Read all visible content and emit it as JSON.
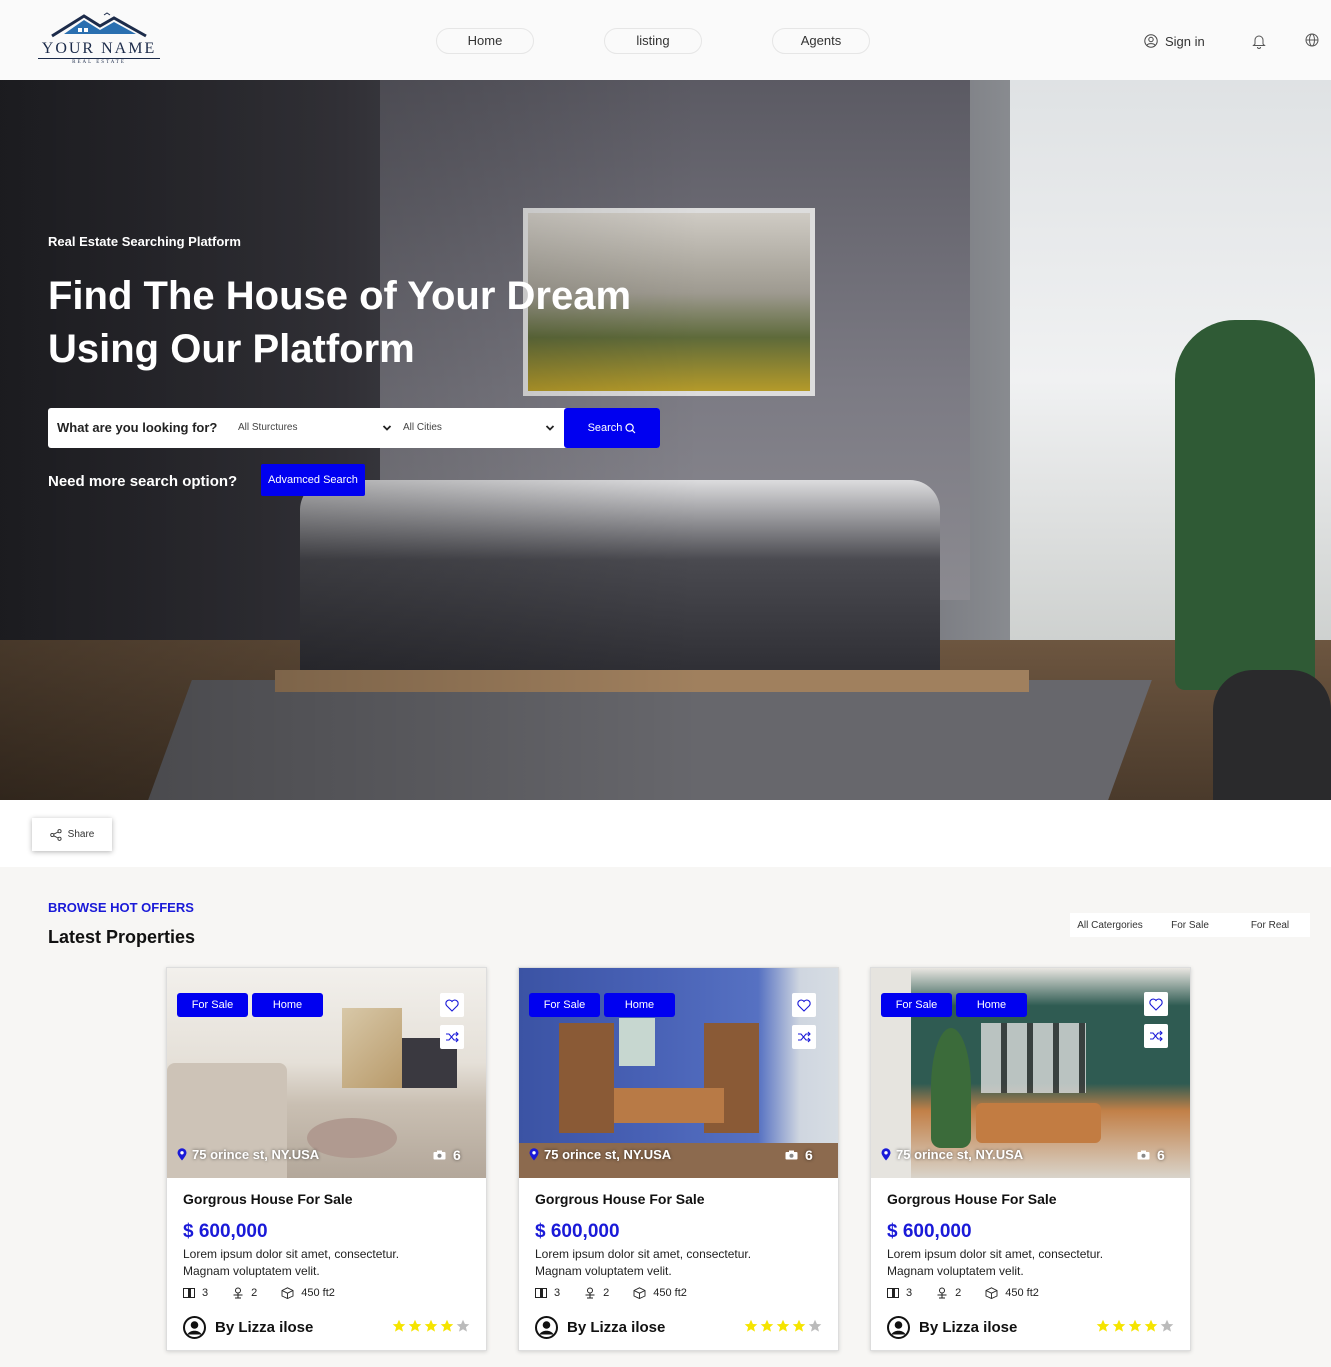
{
  "header": {
    "logo": {
      "name": "YOUR NAME",
      "sub": "REAL ESTATE"
    },
    "nav": [
      "Home",
      "listing",
      "Agents"
    ],
    "signin_label": "Sign in"
  },
  "hero": {
    "tag": "Real Estate Searching Platform",
    "title_line1": "Find The House of Your Dream",
    "title_line2": "Using Our Platform",
    "search": {
      "label": "What are you looking for?",
      "structures_value": "All Sturctures",
      "cities_value": "All Cities",
      "button_label": "Search"
    },
    "more_label": "Need more search option?",
    "advanced_label": "Advamced Search"
  },
  "share_label": "Share",
  "section": {
    "eyebrow": "BROWSE HOT OFFERS",
    "title": "Latest Properties",
    "filters": [
      "All Catergories",
      "For Sale",
      "For Real"
    ]
  },
  "properties": [
    {
      "badges": [
        "For Sale",
        "Home"
      ],
      "address": "75 orince st, NY.USA",
      "photos": "6",
      "title": "Gorgrous House For Sale",
      "price": "$ 600,000",
      "desc_line1": "Lorem ipsum dolor sit amet, consectetur.",
      "desc_line2": "Magnam voluptatem velit.",
      "beds": "3",
      "baths": "2",
      "area": "450 ft2",
      "agent": "By Lizza ilose",
      "rating": 4
    },
    {
      "badges": [
        "For Sale",
        "Home"
      ],
      "address": "75 orince st, NY.USA",
      "photos": "6",
      "title": "Gorgrous House For Sale",
      "price": "$ 600,000",
      "desc_line1": "Lorem ipsum dolor sit amet, consectetur.",
      "desc_line2": "Magnam voluptatem velit.",
      "beds": "3",
      "baths": "2",
      "area": "450 ft2",
      "agent": "By Lizza ilose",
      "rating": 4
    },
    {
      "badges": [
        "For Sale",
        "Home"
      ],
      "address": "75 orince st, NY.USA",
      "photos": "6",
      "title": "Gorgrous House For Sale",
      "price": "$ 600,000",
      "desc_line1": "Lorem ipsum dolor sit amet, consectetur.",
      "desc_line2": "Magnam voluptatem velit.",
      "beds": "3",
      "baths": "2",
      "area": "450 ft2",
      "agent": "By Lizza ilose",
      "rating": 4
    }
  ],
  "colors": {
    "accent": "#0000f0",
    "price": "#1a1ad8",
    "star": "#f5e400",
    "star_empty": "#bbbbbb"
  },
  "icons": [
    "user-icon",
    "bell-icon",
    "globe-icon",
    "chevron-down-icon",
    "search-icon",
    "share-icon",
    "heart-icon",
    "shuffle-icon",
    "location-pin-icon",
    "camera-icon",
    "bed-icon",
    "bath-icon",
    "area-icon",
    "avatar-icon",
    "star-icon"
  ]
}
